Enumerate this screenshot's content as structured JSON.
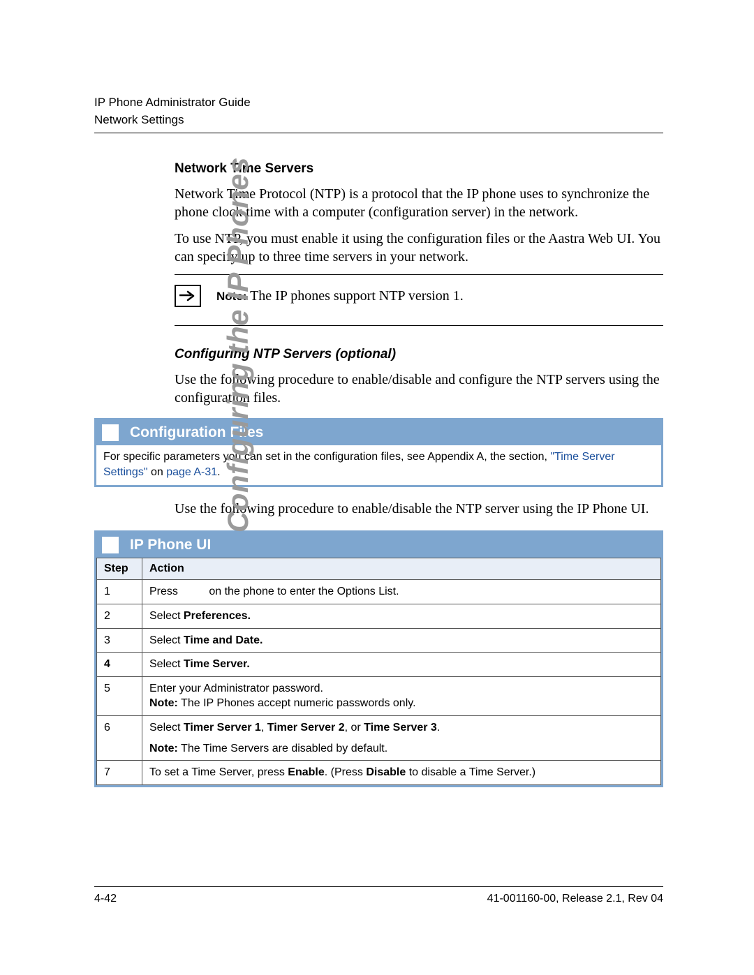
{
  "header": {
    "line1": "IP Phone Administrator Guide",
    "line2": "Network Settings"
  },
  "sidebar_label": "Configuring the IP Phones",
  "section": {
    "title": "Network Time Servers",
    "para1": "Network Time Protocol (NTP) is a protocol that the IP phone uses to synchronize the phone clock time with a computer (configuration server) in the network.",
    "para2": "To use NTP, you must enable it using the configuration files or the Aastra Web UI. You can specify up to three time servers in your network.",
    "note_label": "Note:",
    "note_text": " The IP phones support NTP version 1.",
    "sub_title": "Configuring NTP Servers (optional)",
    "para3": "Use the following procedure to enable/disable and configure the NTP servers using the configuration files."
  },
  "config_panel": {
    "title": "Configuration Files",
    "body_prefix": "For specific parameters you can set in the configuration files, see Appendix A, the section, ",
    "link1": "\"Time Server Settings\"",
    "body_mid": " on ",
    "link2": "page A-31",
    "body_suffix": "."
  },
  "para_after_config": "Use the following procedure to enable/disable the NTP server using the IP Phone UI.",
  "ui_panel": {
    "title": "IP Phone UI",
    "headers": {
      "step": "Step",
      "action": "Action"
    },
    "rows": [
      {
        "step": "1",
        "prefix": "Press",
        "suffix": " on the phone to enter the Options List.",
        "bold_row": false
      },
      {
        "step": "2",
        "prefix": "Select ",
        "bold": "Preferences.",
        "bold_row": false
      },
      {
        "step": "3",
        "prefix": "Select ",
        "bold": "Time and Date.",
        "bold_row": false
      },
      {
        "step": "4",
        "prefix": "Select ",
        "bold": "Time Server.",
        "bold_row": true
      },
      {
        "step": "5",
        "line1": "Enter your Administrator password.",
        "note_label": "Note:",
        "note_text": " The IP Phones accept numeric passwords only.",
        "bold_row": false
      },
      {
        "step": "6",
        "prefix": "Select ",
        "bold1": "Timer Server 1",
        "mid1": ", ",
        "bold2": "Timer Server 2",
        "mid2": ", or ",
        "bold3": "Time Server 3",
        "suffix": ".",
        "gap": true,
        "note_label": "Note:",
        "note_text": " The Time Servers are disabled by default.",
        "bold_row": false
      },
      {
        "step": "7",
        "prefix": "To set a Time Server, press ",
        "bold1": "Enable",
        "mid1": ". (Press ",
        "bold2": "Disable",
        "suffix": " to disable a Time Server.)",
        "bold_row": false
      }
    ]
  },
  "footer": {
    "left": "4-42",
    "right": "41-001160-00, Release 2.1, Rev 04"
  }
}
